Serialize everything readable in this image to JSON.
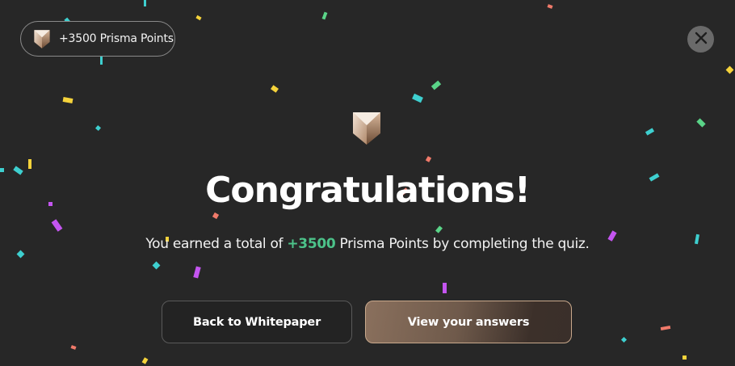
{
  "reward_pill": {
    "text": "+3500 Prisma Points",
    "icon": "prisma-shield-icon"
  },
  "close": {
    "icon": "close-icon"
  },
  "main": {
    "icon": "prisma-shield-icon",
    "title": "Congratulations!",
    "subtitle_before": "You earned a total of ",
    "subtitle_points": "+3500",
    "subtitle_after": " Prisma Points by completing the quiz."
  },
  "actions": {
    "back_label": "Back to Whitepaper",
    "view_label": "View your answers"
  },
  "colors": {
    "background": "#272727",
    "points_green": "#4cc38a",
    "confetti": [
      "#3ecfcf",
      "#f5d33b",
      "#c455f0",
      "#f07a6a",
      "#5ad488"
    ]
  }
}
